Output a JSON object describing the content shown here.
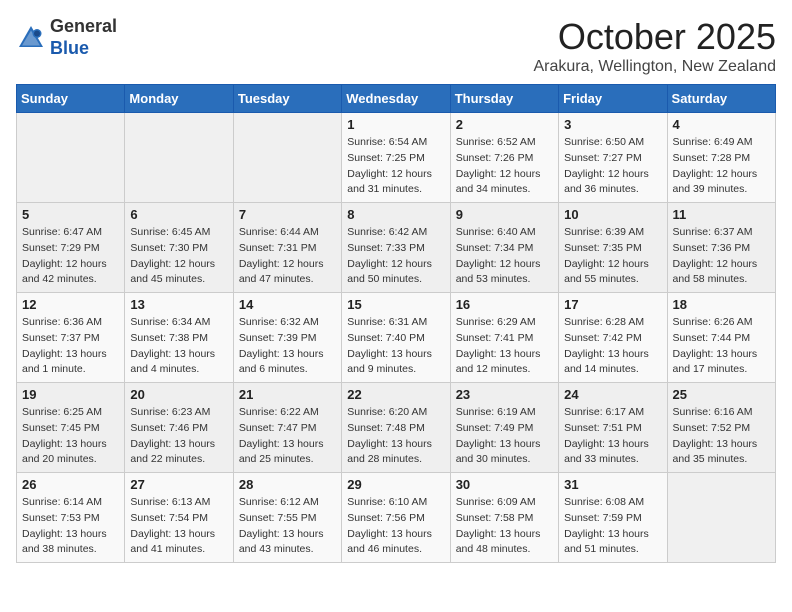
{
  "header": {
    "logo_line1": "General",
    "logo_line2": "Blue",
    "month": "October 2025",
    "location": "Arakura, Wellington, New Zealand"
  },
  "days_of_week": [
    "Sunday",
    "Monday",
    "Tuesday",
    "Wednesday",
    "Thursday",
    "Friday",
    "Saturday"
  ],
  "weeks": [
    [
      {
        "day": "",
        "info": ""
      },
      {
        "day": "",
        "info": ""
      },
      {
        "day": "",
        "info": ""
      },
      {
        "day": "1",
        "info": "Sunrise: 6:54 AM\nSunset: 7:25 PM\nDaylight: 12 hours\nand 31 minutes."
      },
      {
        "day": "2",
        "info": "Sunrise: 6:52 AM\nSunset: 7:26 PM\nDaylight: 12 hours\nand 34 minutes."
      },
      {
        "day": "3",
        "info": "Sunrise: 6:50 AM\nSunset: 7:27 PM\nDaylight: 12 hours\nand 36 minutes."
      },
      {
        "day": "4",
        "info": "Sunrise: 6:49 AM\nSunset: 7:28 PM\nDaylight: 12 hours\nand 39 minutes."
      }
    ],
    [
      {
        "day": "5",
        "info": "Sunrise: 6:47 AM\nSunset: 7:29 PM\nDaylight: 12 hours\nand 42 minutes."
      },
      {
        "day": "6",
        "info": "Sunrise: 6:45 AM\nSunset: 7:30 PM\nDaylight: 12 hours\nand 45 minutes."
      },
      {
        "day": "7",
        "info": "Sunrise: 6:44 AM\nSunset: 7:31 PM\nDaylight: 12 hours\nand 47 minutes."
      },
      {
        "day": "8",
        "info": "Sunrise: 6:42 AM\nSunset: 7:33 PM\nDaylight: 12 hours\nand 50 minutes."
      },
      {
        "day": "9",
        "info": "Sunrise: 6:40 AM\nSunset: 7:34 PM\nDaylight: 12 hours\nand 53 minutes."
      },
      {
        "day": "10",
        "info": "Sunrise: 6:39 AM\nSunset: 7:35 PM\nDaylight: 12 hours\nand 55 minutes."
      },
      {
        "day": "11",
        "info": "Sunrise: 6:37 AM\nSunset: 7:36 PM\nDaylight: 12 hours\nand 58 minutes."
      }
    ],
    [
      {
        "day": "12",
        "info": "Sunrise: 6:36 AM\nSunset: 7:37 PM\nDaylight: 13 hours\nand 1 minute."
      },
      {
        "day": "13",
        "info": "Sunrise: 6:34 AM\nSunset: 7:38 PM\nDaylight: 13 hours\nand 4 minutes."
      },
      {
        "day": "14",
        "info": "Sunrise: 6:32 AM\nSunset: 7:39 PM\nDaylight: 13 hours\nand 6 minutes."
      },
      {
        "day": "15",
        "info": "Sunrise: 6:31 AM\nSunset: 7:40 PM\nDaylight: 13 hours\nand 9 minutes."
      },
      {
        "day": "16",
        "info": "Sunrise: 6:29 AM\nSunset: 7:41 PM\nDaylight: 13 hours\nand 12 minutes."
      },
      {
        "day": "17",
        "info": "Sunrise: 6:28 AM\nSunset: 7:42 PM\nDaylight: 13 hours\nand 14 minutes."
      },
      {
        "day": "18",
        "info": "Sunrise: 6:26 AM\nSunset: 7:44 PM\nDaylight: 13 hours\nand 17 minutes."
      }
    ],
    [
      {
        "day": "19",
        "info": "Sunrise: 6:25 AM\nSunset: 7:45 PM\nDaylight: 13 hours\nand 20 minutes."
      },
      {
        "day": "20",
        "info": "Sunrise: 6:23 AM\nSunset: 7:46 PM\nDaylight: 13 hours\nand 22 minutes."
      },
      {
        "day": "21",
        "info": "Sunrise: 6:22 AM\nSunset: 7:47 PM\nDaylight: 13 hours\nand 25 minutes."
      },
      {
        "day": "22",
        "info": "Sunrise: 6:20 AM\nSunset: 7:48 PM\nDaylight: 13 hours\nand 28 minutes."
      },
      {
        "day": "23",
        "info": "Sunrise: 6:19 AM\nSunset: 7:49 PM\nDaylight: 13 hours\nand 30 minutes."
      },
      {
        "day": "24",
        "info": "Sunrise: 6:17 AM\nSunset: 7:51 PM\nDaylight: 13 hours\nand 33 minutes."
      },
      {
        "day": "25",
        "info": "Sunrise: 6:16 AM\nSunset: 7:52 PM\nDaylight: 13 hours\nand 35 minutes."
      }
    ],
    [
      {
        "day": "26",
        "info": "Sunrise: 6:14 AM\nSunset: 7:53 PM\nDaylight: 13 hours\nand 38 minutes."
      },
      {
        "day": "27",
        "info": "Sunrise: 6:13 AM\nSunset: 7:54 PM\nDaylight: 13 hours\nand 41 minutes."
      },
      {
        "day": "28",
        "info": "Sunrise: 6:12 AM\nSunset: 7:55 PM\nDaylight: 13 hours\nand 43 minutes."
      },
      {
        "day": "29",
        "info": "Sunrise: 6:10 AM\nSunset: 7:56 PM\nDaylight: 13 hours\nand 46 minutes."
      },
      {
        "day": "30",
        "info": "Sunrise: 6:09 AM\nSunset: 7:58 PM\nDaylight: 13 hours\nand 48 minutes."
      },
      {
        "day": "31",
        "info": "Sunrise: 6:08 AM\nSunset: 7:59 PM\nDaylight: 13 hours\nand 51 minutes."
      },
      {
        "day": "",
        "info": ""
      }
    ]
  ]
}
